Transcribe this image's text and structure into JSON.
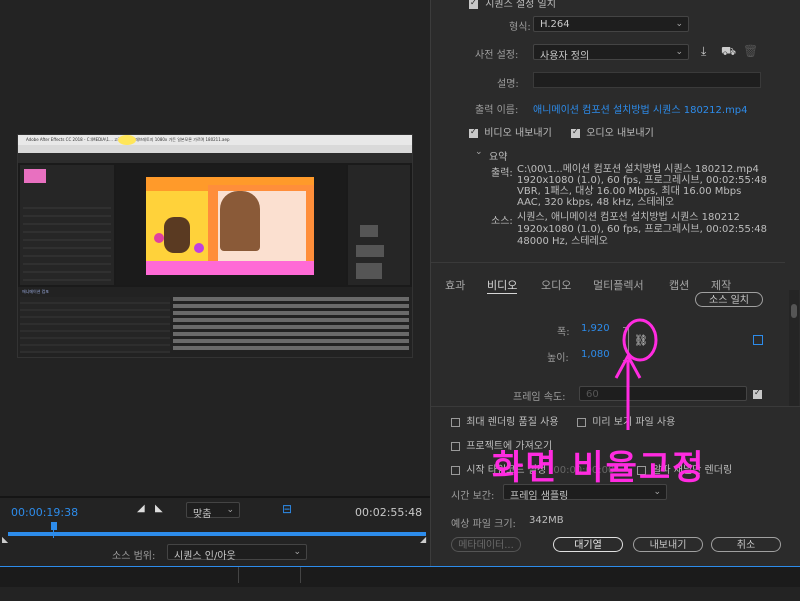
{
  "preview": {
    "title_bar": "Adobe After Effects CC 2018 - C:\\MEDIA\\1... 고정 저는 텔레브레토지 1080x 가든 일본모론 가르며 180211.aep",
    "timeline_label": "애니메이션 컴포"
  },
  "transport": {
    "current_time": "00:00:19:38",
    "fit_label": "맞춤",
    "end_time": "00:02:55:48",
    "source_range_label": "소스 범위:",
    "source_range_value": "시퀀스 인/아웃"
  },
  "export": {
    "top_checkbox_label": "시퀀스 설정 일치",
    "format_label": "형식:",
    "format_value": "H.264",
    "preset_label": "사전 설정:",
    "preset_value": "사용자 정의",
    "comment_label": "설명:",
    "output_label": "출력 이름:",
    "output_value": "애니메이션 컴포션 설치방법 시퀀스 180212.mp4",
    "export_video_label": "비디오 내보내기",
    "export_audio_label": "오디오 내보내기"
  },
  "summary": {
    "header": "요약",
    "output_label": "출력:",
    "output_lines": [
      "C:\\00\\1...메이션 컴포션 설치방법 시퀀스 180212.mp4",
      "1920x1080 (1.0), 60 fps, 프로그레시브, 00:02:55:48",
      "VBR, 1패스, 대상 16.00 Mbps, 최대 16.00 Mbps",
      "AAC, 320 kbps, 48 kHz, 스테레오"
    ],
    "source_label": "소스:",
    "source_lines": [
      "시퀀스, 애니메이션 컴포션 설치방법 시퀀스 180212",
      "1920x1080 (1.0), 60 fps, 프로그레시브, 00:02:55:48",
      "48000 Hz, 스테레오"
    ]
  },
  "tabs": [
    "효과",
    "비디오",
    "오디오",
    "멀티플렉서",
    "캡션",
    "제작"
  ],
  "video": {
    "match_source_btn": "소스 일치",
    "width_label": "폭:",
    "width_value": "1,920",
    "height_label": "높이:",
    "height_value": "1,080",
    "frame_rate_label": "프레임 속도:",
    "frame_rate_value": "60"
  },
  "options": {
    "max_render": "최대 렌더링 품질 사용",
    "use_preview": "미리 보기 파일 사용",
    "import_project": "프로젝트에 가져오기",
    "set_start_tc": "시작 타임코드 설정",
    "start_tc_value": "00:00:00:00",
    "alpha_only": "알파 채널만 렌더링",
    "time_interp_label": "시간 보간:",
    "time_interp_value": "프레임 샘플링",
    "file_size_label": "예상 파일 크기:",
    "file_size_value": "342MB"
  },
  "buttons": {
    "metadata": "메타데이터...",
    "queue": "대기열",
    "export": "내보내기",
    "cancel": "취소"
  },
  "annotation": {
    "text": "화면 비율고정",
    "color": "#ff2be0"
  }
}
